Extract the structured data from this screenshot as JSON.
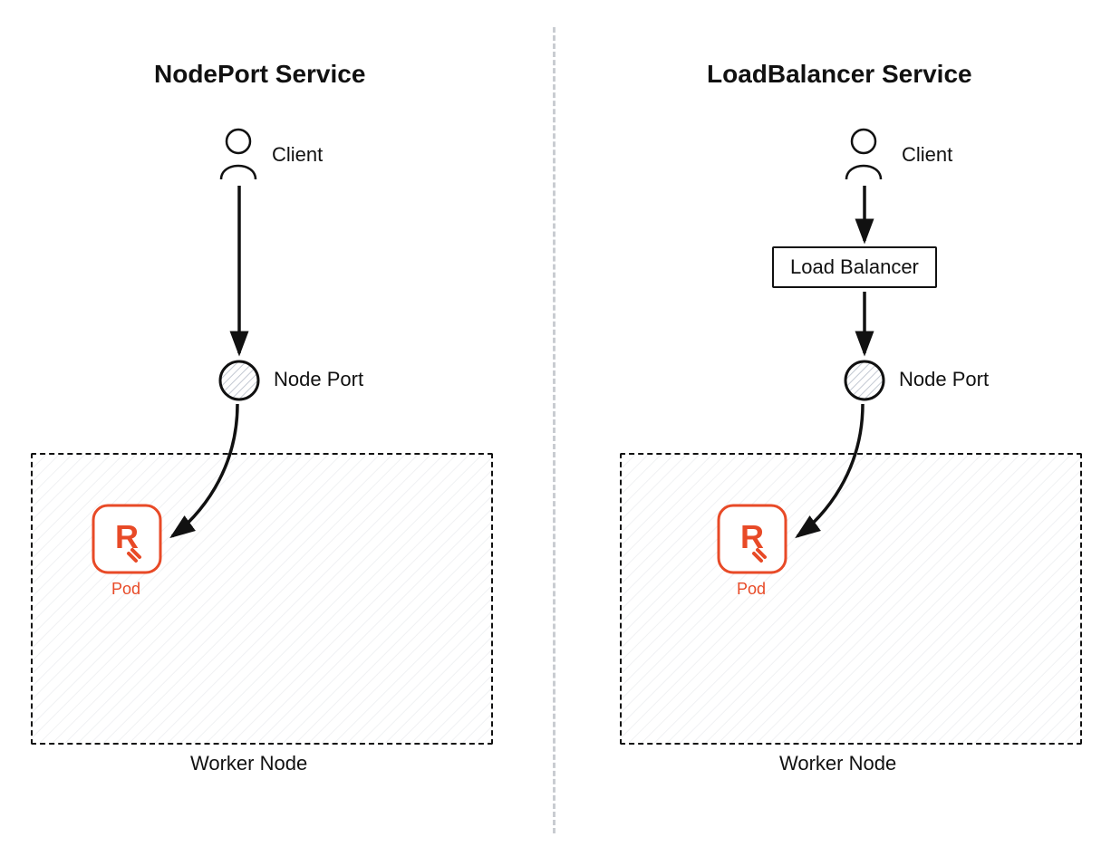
{
  "left": {
    "title": "NodePort Service",
    "client_label": "Client",
    "nodeport_label": "Node Port",
    "pod_label": "Pod",
    "worker_label": "Worker Node"
  },
  "right": {
    "title": "LoadBalancer Service",
    "client_label": "Client",
    "lb_label": "Load Balancer",
    "nodeport_label": "Node Port",
    "pod_label": "Pod",
    "worker_label": "Worker Node"
  },
  "colors": {
    "accent": "#e84a27",
    "ink": "#111111",
    "hatch": "#8893a5",
    "divider": "#c9ccd1"
  }
}
